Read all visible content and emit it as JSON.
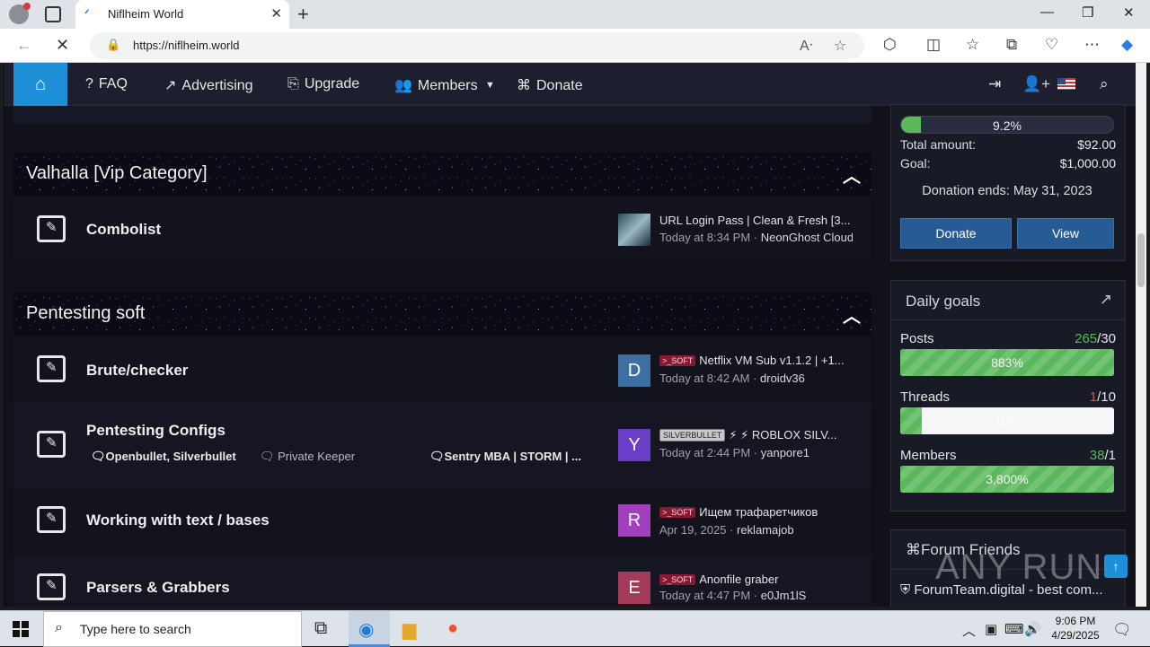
{
  "browser": {
    "tab_title": "Niflheim World",
    "url": "https://niflheim.world",
    "new_tab": "+",
    "minimize": "—",
    "maximize": "❐",
    "close": "✕"
  },
  "navbar": {
    "items": [
      {
        "icon": "?",
        "label": "FAQ"
      },
      {
        "icon": "↗",
        "label": "Advertising"
      },
      {
        "icon": "⎘",
        "label": "Upgrade"
      },
      {
        "icon": "👥",
        "label": "Members"
      },
      {
        "icon": "⌘",
        "label": "Donate"
      }
    ]
  },
  "categories": [
    {
      "title": "Valhalla [Vip Category]",
      "nodes": [
        {
          "title": "Combolist",
          "last_title": "URL Login Pass | Clean & Fresh [3...",
          "last_meta_time": "Today at 8:34 PM · ",
          "last_meta_user": "NeonGhost Cloud"
        }
      ]
    },
    {
      "title": "Pentesting soft",
      "nodes": [
        {
          "title": "Brute/checker",
          "avatar": "D",
          "prefix": ">_SOFT",
          "last_title": "Netflix VM Sub v1.1.2 | +1...",
          "last_meta_time": "Today at 8:42 AM · ",
          "last_meta_user": "droidv36"
        },
        {
          "title": "Pentesting Configs",
          "avatar": "Y",
          "prefix": "SILVERBULLET",
          "last_title": "⚡ ⚡ ROBLOX SILV...",
          "last_meta_time": "Today at 2:44 PM · ",
          "last_meta_user": "yanpore1",
          "subforums": [
            "Openbullet, Silverbullet",
            "Private Keeper",
            "Sentry MBA | STORM | ..."
          ]
        },
        {
          "title": "Working with text / bases",
          "avatar": "R",
          "prefix": ">_SOFT",
          "last_title": "Ищем трафаретчиков",
          "last_meta_time": "Apr 19, 2025 · ",
          "last_meta_user": "reklamajob"
        },
        {
          "title": "Parsers & Grabbers",
          "avatar": "E",
          "prefix": ">_SOFT",
          "last_title": "Anonfile graber",
          "last_meta_time": "Today at 4:47 PM · ",
          "last_meta_user": "e0Jm1lS"
        }
      ]
    }
  ],
  "donation": {
    "progress_label": "9.2%",
    "progress_percent": 9.2,
    "total_label": "Total amount:",
    "total_value": "$92.00",
    "goal_label": "Goal:",
    "goal_value": "$1,000.00",
    "ends": "Donation ends: May 31, 2023",
    "donate_btn": "Donate",
    "view_btn": "View"
  },
  "daily_goals": {
    "title": "Daily goals",
    "goals": [
      {
        "label": "Posts",
        "current": "265",
        "target": "/30",
        "percent_label": "883%",
        "fill_percent": 100,
        "current_color": "#5cb85c"
      },
      {
        "label": "Threads",
        "current": "1",
        "target": "/10",
        "percent_label": "10%",
        "fill_percent": 10,
        "current_color": "#d9534f"
      },
      {
        "label": "Members",
        "current": "38",
        "target": "/1",
        "percent_label": "3,800%",
        "fill_percent": 100,
        "current_color": "#5cb85c"
      }
    ]
  },
  "forum_friends": {
    "title": "Forum Friends",
    "first_item": "ForumTeam.digital - best com..."
  },
  "watermark": "ANY RUN",
  "taskbar": {
    "search_placeholder": "Type here to search",
    "time": "9:06 PM",
    "date": "4/29/2025"
  },
  "colors": {
    "accent": "#1e90d8",
    "button": "#275b96",
    "progress": "#5cb85c"
  }
}
